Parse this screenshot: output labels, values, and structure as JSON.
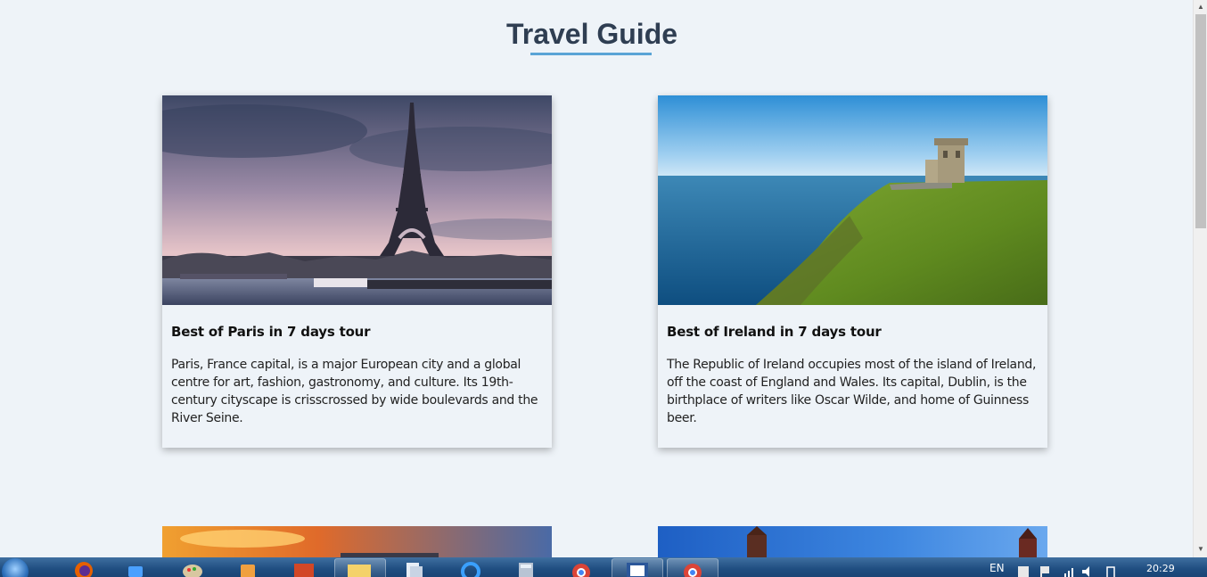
{
  "page": {
    "title": "Travel Guide"
  },
  "cards": [
    {
      "title": "Best of Paris in 7 days tour",
      "description": "Paris, France capital, is a major European city and a global centre for art, fashion, gastronomy, and culture. Its 19th-century cityscape is crisscrossed by wide boulevards and the River Seine.",
      "image": "eiffel-tower-photo"
    },
    {
      "title": "Best of Ireland in 7 days tour",
      "description": "The Republic of Ireland occupies most of the island of Ireland, off the coast of England and Wales. Its capital, Dublin, is the birthplace of writers like Oscar Wilde, and home of Guinness beer.",
      "image": "cliffs-of-moher-photo"
    }
  ],
  "taskbar": {
    "language": "EN",
    "clock": "20:29"
  },
  "colors": {
    "background": "#eef3f8",
    "title": "#2f3e52",
    "underline": "#5aa4d6"
  }
}
